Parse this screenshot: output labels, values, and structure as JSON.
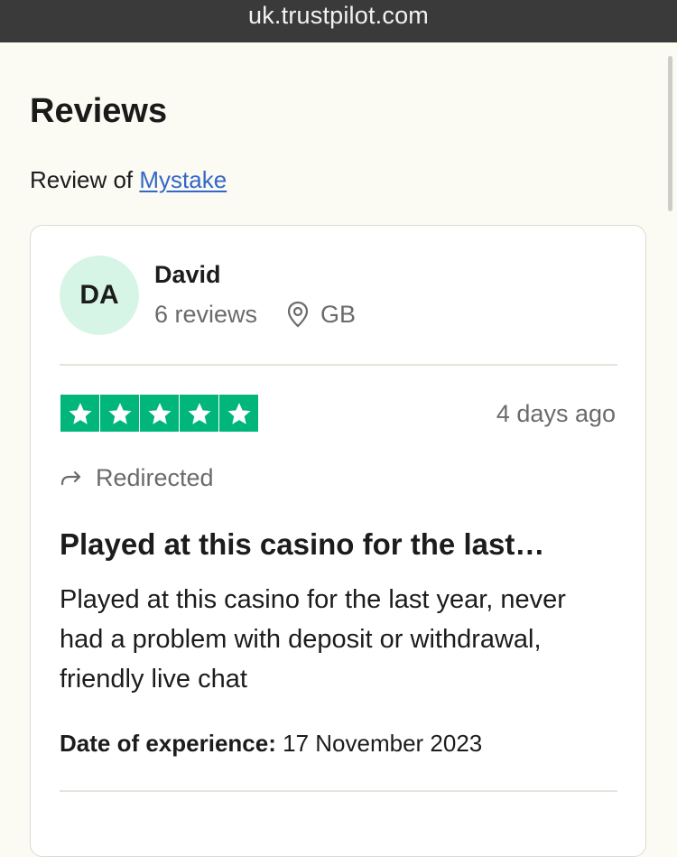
{
  "browser": {
    "url": "uk.trustpilot.com"
  },
  "page": {
    "title": "Reviews",
    "review_of_prefix": "Review of",
    "company_link": "Mystake"
  },
  "review": {
    "avatar_initials": "DA",
    "reviewer_name": "David",
    "reviewer_review_count": "6 reviews",
    "reviewer_country": "GB",
    "rating": 5,
    "rating_max": 5,
    "date": "4 days ago",
    "status": "Redirected",
    "title": "Played at this casino for the last…",
    "body": "Played at this casino for the last year, never had a problem with deposit or withdrawal, friendly live chat",
    "experience_label": "Date of experience:",
    "experience_date": "17 November 2023"
  },
  "colors": {
    "star_green": "#00b67a",
    "avatar_bg": "#d7f5e7",
    "link_blue": "#3568c6",
    "page_bg": "#fbfaf3"
  },
  "icons": {
    "location": "location-pin-icon",
    "redirect": "redirect-arrow-icon",
    "star": "star-icon"
  }
}
